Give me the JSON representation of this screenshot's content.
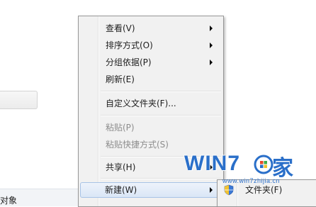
{
  "background": {
    "bottom_text": "对象"
  },
  "context_menu": {
    "items": [
      {
        "label": "查看(V)",
        "has_submenu": true
      },
      {
        "label": "排序方式(O)",
        "has_submenu": true
      },
      {
        "label": "分组依据(P)",
        "has_submenu": true
      },
      {
        "label": "刷新(E)"
      },
      {
        "label": "自定义文件夹(F)..."
      },
      {
        "label": "粘贴(P)",
        "disabled": true
      },
      {
        "label": "粘贴快捷方式(S)",
        "disabled": true
      },
      {
        "label": "共享(H)",
        "has_submenu": true
      },
      {
        "label": "新建(W)",
        "has_submenu": true,
        "highlighted": true
      }
    ]
  },
  "submenu": {
    "items": [
      {
        "label": "文件夹(F)",
        "icon": "shield-icon"
      }
    ]
  },
  "watermark": {
    "brand": "WIN7",
    "suffix": "家",
    "url": "www.win7zhijia.cn"
  },
  "colors": {
    "menu_bg": "#f1f1f1",
    "highlight_border": "#a8c3e6",
    "watermark_blue": "#2a6fc9",
    "disabled_text": "#8d8d8d"
  }
}
